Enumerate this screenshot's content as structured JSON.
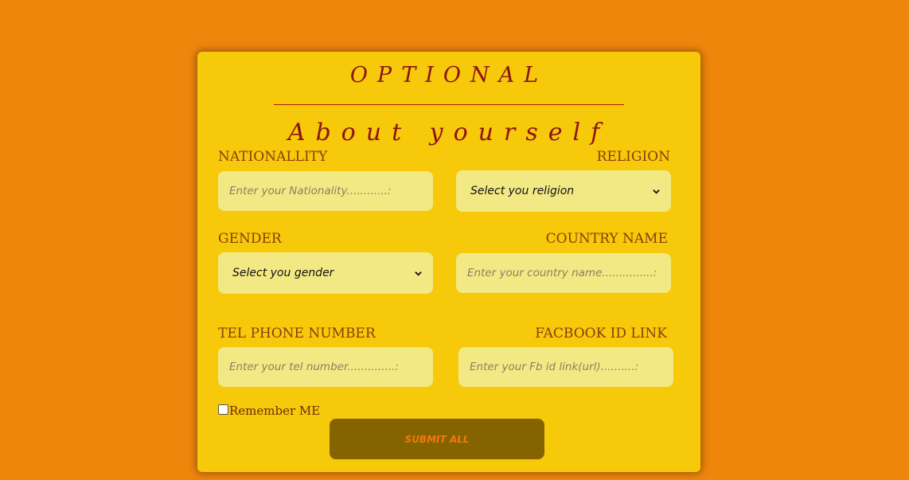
{
  "form": {
    "title": "OPTIONAL",
    "subtitle": "About yourself",
    "nationality": {
      "label": "NATIONALLITY",
      "placeholder": "Enter your Nationality............:",
      "value": ""
    },
    "religion": {
      "label": "RELIGION",
      "selected": "Select you religion"
    },
    "gender": {
      "label": "GENDER",
      "selected": "Select you gender"
    },
    "country": {
      "label": "COUNTRY NAME",
      "placeholder": "Enter your country name...............:",
      "value": ""
    },
    "phone": {
      "label": "TEL PHONE NUMBER",
      "placeholder": "Enter your tel number..............:",
      "value": ""
    },
    "facebook": {
      "label": "FACBOOK ID LINK",
      "placeholder": "Enter your Fb id link(url)..........:",
      "value": ""
    },
    "remember_label": "Remember ME",
    "remember_checked": false,
    "submit_label": "SUBMIT ALL"
  },
  "colors": {
    "page_background": "#ee860c",
    "card_background": "#f6c90a",
    "field_background": "#f3e984",
    "title_color": "#8b1410",
    "label_color": "#8b3d0a",
    "submit_background": "#856400",
    "submit_text": "#f5780e"
  },
  "icons": {
    "select_arrow": "chevron-down-icon"
  }
}
